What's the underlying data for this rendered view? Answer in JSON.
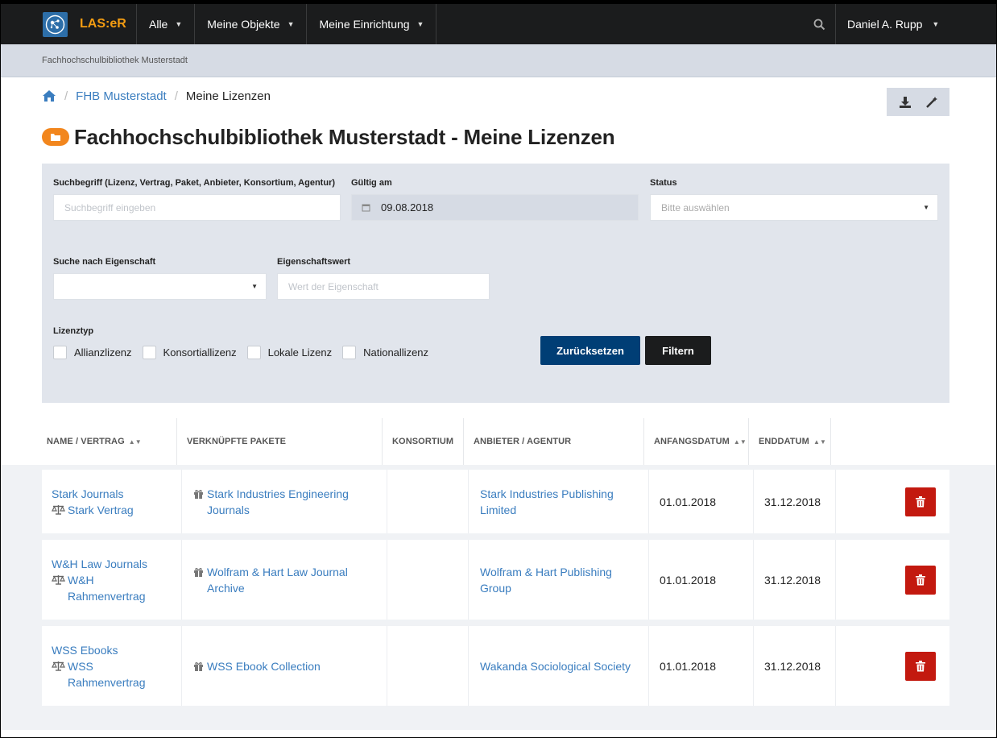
{
  "navbar": {
    "logo_text": "LAS:eR",
    "menu": [
      {
        "label": "Alle"
      },
      {
        "label": "Meine Objekte"
      },
      {
        "label": "Meine Einrichtung"
      }
    ],
    "user": "Daniel A. Rupp"
  },
  "context": {
    "org": "Fachhochschulbibliothek Musterstadt"
  },
  "breadcrumb": {
    "items": [
      "FHB Musterstadt",
      "Meine Lizenzen"
    ]
  },
  "page": {
    "title": "Fachhochschulbibliothek Musterstadt - Meine Lizenzen"
  },
  "filter": {
    "search_label": "Suchbegriff (Lizenz, Vertrag, Paket, Anbieter, Konsortium, Agentur)",
    "search_placeholder": "Suchbegriff eingeben",
    "valid_label": "Gültig am",
    "valid_value": "09.08.2018",
    "status_label": "Status",
    "status_placeholder": "Bitte auswählen",
    "property_label": "Suche nach Eigenschaft",
    "property_value_label": "Eigenschaftswert",
    "property_value_placeholder": "Wert der Eigenschaft",
    "license_type_label": "Lizenztyp",
    "license_types": [
      "Allianzlizenz",
      "Konsortiallizenz",
      "Lokale Lizenz",
      "Nationallizenz"
    ],
    "reset_label": "Zurücksetzen",
    "filter_label": "Filtern"
  },
  "table": {
    "headers": [
      "NAME / VERTRAG",
      "VERKNÜPFTE PAKETE",
      "KONSORTIUM",
      "ANBIETER / AGENTUR",
      "ANFANGSDATUM",
      "ENDDATUM"
    ],
    "rows": [
      {
        "name": "Stark Journals",
        "contract": [
          "Stark Vertrag"
        ],
        "package": [
          "Stark Industries Engineering",
          "Journals"
        ],
        "consortium": "",
        "provider": [
          "Stark Industries Publishing",
          "Limited"
        ],
        "start": "01.01.2018",
        "end": "31.12.2018"
      },
      {
        "name": "W&H Law Journals",
        "contract": [
          "W&H",
          "Rahmenvertrag"
        ],
        "package": [
          "Wolfram & Hart Law Journal",
          "Archive"
        ],
        "consortium": "",
        "provider": [
          "Wolfram & Hart Publishing",
          "Group"
        ],
        "start": "01.01.2018",
        "end": "31.12.2018"
      },
      {
        "name": "WSS Ebooks",
        "contract": [
          "WSS",
          "Rahmenvertrag"
        ],
        "package": [
          "WSS Ebook Collection"
        ],
        "consortium": "",
        "provider": [
          "Wakanda Sociological Society"
        ],
        "start": "01.01.2018",
        "end": "31.12.2018"
      }
    ]
  },
  "colors": {
    "navbar": "#1b1c1d",
    "link": "#3a7dbf",
    "primary_button": "#003e75",
    "delete_button": "#c3190f",
    "accent": "#f2861d"
  }
}
